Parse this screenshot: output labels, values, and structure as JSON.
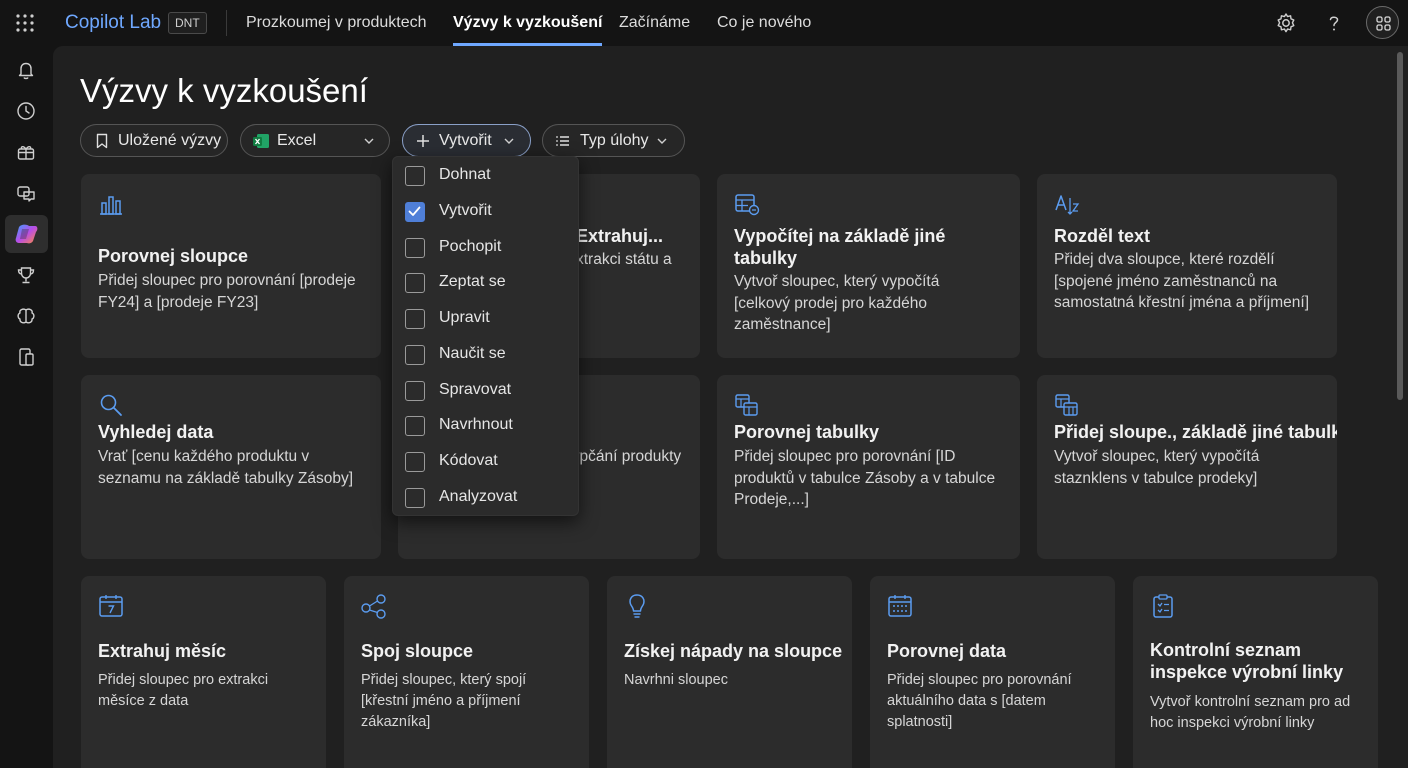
{
  "header": {
    "app_name": "Copilot Lab",
    "badge": "DNT",
    "nav": [
      "Prozkoumej v produktech",
      "Výzvy k vyzkoušení",
      "Začínáme",
      "Co je nového"
    ],
    "active_nav": "Výzvy k vyzkoušení",
    "icons": [
      "waffle-icon",
      "settings-icon",
      "help-icon",
      "avatar"
    ]
  },
  "rail": {
    "icons": [
      "bell-icon",
      "history-icon",
      "gift-icon",
      "chat-icon",
      "copilot-icon",
      "trophy-icon",
      "brain-icon",
      "device-icon"
    ],
    "active": "copilot-icon"
  },
  "page": {
    "title": "Výzvy k vyzkoušení"
  },
  "filters": {
    "saved": "Uložené výzvy",
    "app": "Excel",
    "create": "Vytvořit",
    "task_type": "Typ úlohy"
  },
  "dropdown": {
    "items": [
      {
        "label": "Dohnat",
        "checked": false
      },
      {
        "label": "Vytvořit",
        "checked": true
      },
      {
        "label": "Pochopit",
        "checked": false
      },
      {
        "label": "Zeptat se",
        "checked": false
      },
      {
        "label": "Upravit",
        "checked": false
      },
      {
        "label": "Naučit se",
        "checked": false
      },
      {
        "label": "Spravovat",
        "checked": false
      },
      {
        "label": "Navrhnout",
        "checked": false
      },
      {
        "label": "Kódovat",
        "checked": false
      },
      {
        "label": "Analyzovat",
        "checked": false
      }
    ]
  },
  "cards": {
    "row1": [
      {
        "icon": "bar-chart-icon",
        "title": "Porovnej sloupce",
        "desc": "Přidej sloupec pro porovnání [prodeje FY24] a [prodeje FY23]"
      },
      {
        "icon": "extract-icon",
        "title": "Extrahuj...",
        "desc": "xtrakci státu a"
      },
      {
        "icon": "table-calc-icon",
        "title": "Vypočítej na základě jiné tabulky",
        "desc": "Vytvoř sloupec, který vypočítá [celkový prodej pro každého zaměstnance]"
      },
      {
        "icon": "text-split-icon",
        "title": "Rozděl text",
        "desc": "Přidej dva sloupce, které rozdělí [spojené jméno zaměstnanců na samostatná křestní jména a příjmení]"
      }
    ],
    "row2": [
      {
        "icon": "search-icon",
        "title": "Vyhledej data",
        "desc": "Vrať [cenu každého produktu v seznamu na základě tabulky Zásoby]"
      },
      {
        "icon": "compare-icon",
        "title": "",
        "desc": "vypčání produkty"
      },
      {
        "icon": "compare-tables-icon",
        "title": "Porovnej tabulky",
        "desc": "Přidej sloupec pro porovnání [ID produktů v tabulce Zásoby a v tabulce Prodeje,...]"
      },
      {
        "icon": "add-column-icon",
        "title": "Přidej sloupe., základě jiné tabulky",
        "desc": "Vytvoř sloupec, který vypočítá staznklens v tabulce prodeky]"
      }
    ],
    "row3": [
      {
        "icon": "calendar-icon",
        "title": "Extrahuj měsíc",
        "desc": "Přidej sloupec pro extrakci měsíce z data"
      },
      {
        "icon": "merge-icon",
        "title": "Spoj sloupce",
        "desc": "Přidej sloupec, který spojí [křestní jméno a příjmení zákazníka]"
      },
      {
        "icon": "lightbulb-icon",
        "title": "Získej nápady na sloupce",
        "desc": "Navrhni sloupec"
      },
      {
        "icon": "calendar-grid-icon",
        "title": "Porovnej data",
        "desc": "Přidej sloupec pro porovnání aktuálního data s [datem splatnosti]"
      },
      {
        "icon": "checklist-icon",
        "title": "Kontrolní seznam inspekce výrobní linky",
        "desc": "Vytvoř kontrolní seznam pro ad hoc inspekci výrobní linky"
      }
    ]
  },
  "colors": {
    "accent": "#6fa8ff",
    "checkbox_checked": "#4f7fd8",
    "card_bg": "#2c2c2c",
    "panel_bg": "#202020",
    "page_bg": "#141414"
  }
}
